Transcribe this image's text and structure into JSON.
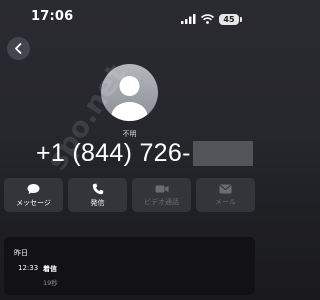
{
  "status_bar": {
    "time": "17:06",
    "battery": "45"
  },
  "contact": {
    "label": "不明",
    "number_visible": "+1 (844) 726-"
  },
  "actions": [
    {
      "label": "メッセージ",
      "icon": "message-bubble-icon",
      "enabled": true
    },
    {
      "label": "発信",
      "icon": "phone-icon",
      "enabled": true
    },
    {
      "label": "ビデオ通話",
      "icon": "video-camera-icon",
      "enabled": false
    },
    {
      "label": "メール",
      "icon": "envelope-icon",
      "enabled": false
    }
  ],
  "watermark": "spo.net",
  "call_history": {
    "date_header": "昨日",
    "entries": [
      {
        "time": "12:33",
        "type": "着信",
        "duration": "19秒"
      }
    ]
  }
}
